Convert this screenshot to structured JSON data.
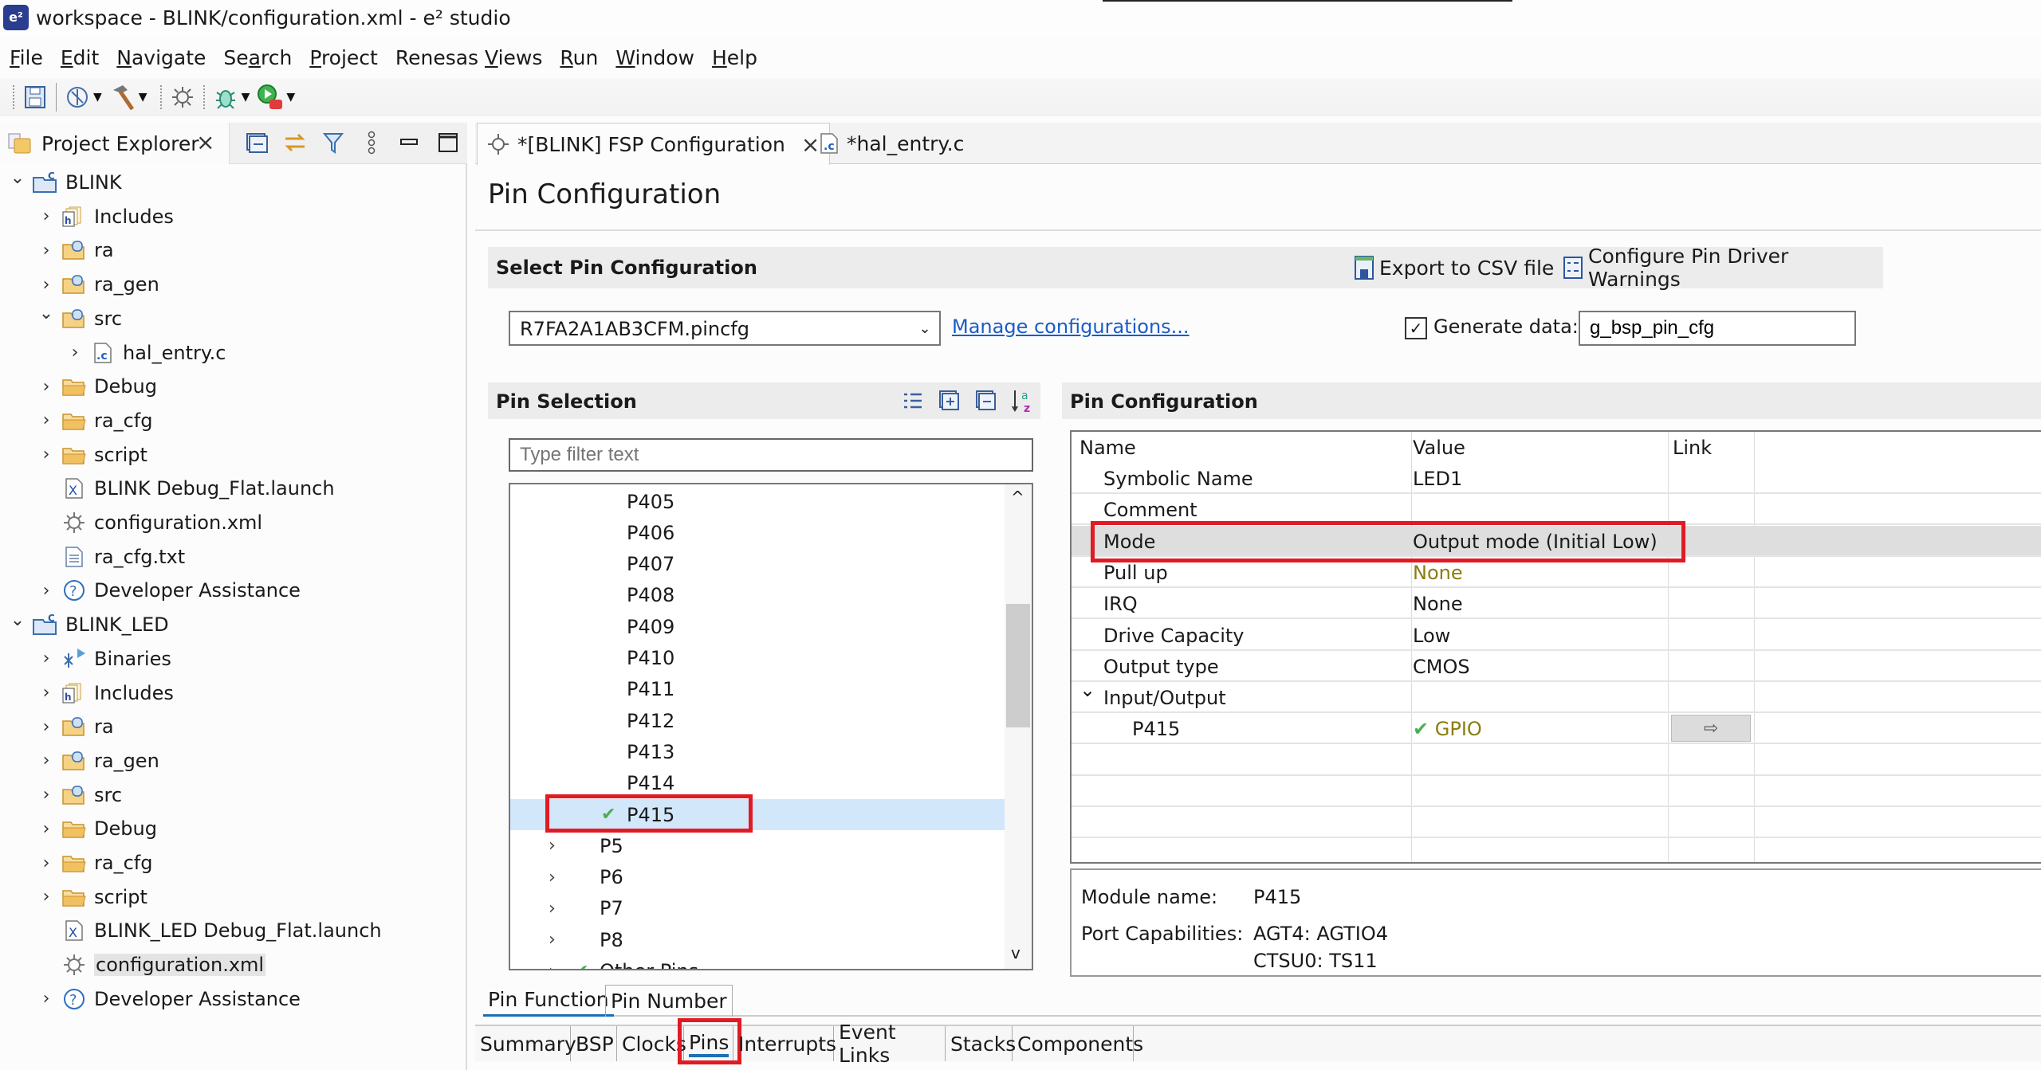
{
  "window": {
    "title": "workspace - BLINK/configuration.xml - e² studio",
    "app_icon": "e2-studio-icon"
  },
  "menu": [
    {
      "label": "File",
      "mnemonic": "F",
      "rest": "ile"
    },
    {
      "label": "Edit",
      "mnemonic": "E",
      "rest": "dit"
    },
    {
      "label": "Navigate",
      "mnemonic": "N",
      "rest": "avigate"
    },
    {
      "label": "Search",
      "pre": "Se",
      "mnemonic": "a",
      "rest": "rch"
    },
    {
      "label": "Project",
      "mnemonic": "P",
      "rest": "roject"
    },
    {
      "label": "Renesas Views",
      "pre": "Renesas ",
      "mnemonic": "V",
      "rest": "iews"
    },
    {
      "label": "Run",
      "mnemonic": "R",
      "rest": "un"
    },
    {
      "label": "Window",
      "mnemonic": "W",
      "rest": "indow"
    },
    {
      "label": "Help",
      "mnemonic": "H",
      "rest": "elp"
    }
  ],
  "toolbar": {
    "icons": [
      "save-icon",
      "build-configuration-icon",
      "build-hammer-icon",
      "fsp-settings-icon",
      "debug-icon",
      "run-icon"
    ]
  },
  "project_explorer": {
    "title": "Project Explorer",
    "tree": [
      {
        "label": "BLINK",
        "level": 0,
        "chevron": "down",
        "icon": "c-project"
      },
      {
        "label": "Includes",
        "level": 1,
        "chevron": "right",
        "icon": "includes"
      },
      {
        "label": "ra",
        "level": 1,
        "chevron": "right",
        "icon": "src-folder"
      },
      {
        "label": "ra_gen",
        "level": 1,
        "chevron": "right",
        "icon": "src-folder"
      },
      {
        "label": "src",
        "level": 1,
        "chevron": "down",
        "icon": "src-folder"
      },
      {
        "label": "hal_entry.c",
        "level": 2,
        "chevron": "right",
        "icon": "c-file"
      },
      {
        "label": "Debug",
        "level": 1,
        "chevron": "right",
        "icon": "folder"
      },
      {
        "label": "ra_cfg",
        "level": 1,
        "chevron": "right",
        "icon": "folder"
      },
      {
        "label": "script",
        "level": 1,
        "chevron": "right",
        "icon": "folder"
      },
      {
        "label": "BLINK Debug_Flat.launch",
        "level": 1,
        "chevron": "",
        "icon": "launch-file"
      },
      {
        "label": "configuration.xml",
        "level": 1,
        "chevron": "",
        "icon": "config-file"
      },
      {
        "label": "ra_cfg.txt",
        "level": 1,
        "chevron": "",
        "icon": "text-file"
      },
      {
        "label": "Developer Assistance",
        "level": 1,
        "chevron": "right",
        "icon": "help"
      },
      {
        "label": "BLINK_LED",
        "level": 0,
        "chevron": "down",
        "icon": "c-project"
      },
      {
        "label": "Binaries",
        "level": 1,
        "chevron": "right",
        "icon": "binaries"
      },
      {
        "label": "Includes",
        "level": 1,
        "chevron": "right",
        "icon": "includes"
      },
      {
        "label": "ra",
        "level": 1,
        "chevron": "right",
        "icon": "src-folder"
      },
      {
        "label": "ra_gen",
        "level": 1,
        "chevron": "right",
        "icon": "src-folder"
      },
      {
        "label": "src",
        "level": 1,
        "chevron": "right",
        "icon": "src-folder"
      },
      {
        "label": "Debug",
        "level": 1,
        "chevron": "right",
        "icon": "folder"
      },
      {
        "label": "ra_cfg",
        "level": 1,
        "chevron": "right",
        "icon": "folder"
      },
      {
        "label": "script",
        "level": 1,
        "chevron": "right",
        "icon": "folder"
      },
      {
        "label": "BLINK_LED Debug_Flat.launch",
        "level": 1,
        "chevron": "",
        "icon": "launch-file"
      },
      {
        "label": "configuration.xml",
        "level": 1,
        "chevron": "",
        "icon": "config-file",
        "selected": true
      },
      {
        "label": "Developer Assistance",
        "level": 1,
        "chevron": "right",
        "icon": "help"
      }
    ]
  },
  "editor_tabs": [
    {
      "label": "*[BLINK] FSP Configuration",
      "active": true,
      "closable": true
    },
    {
      "label": "*hal_entry.c",
      "active": false
    }
  ],
  "page": {
    "title": "Pin Configuration",
    "select_section": "Select Pin Configuration",
    "export_csv": "Export to CSV file",
    "configure_warnings": "Configure Pin Driver Warnings",
    "config_file": "R7FA2A1AB3CFM.pincfg",
    "manage_link": "Manage configurations...",
    "generate_data_label": "Generate data:",
    "generate_data_checked": true,
    "generate_data_value": "g_bsp_pin_cfg"
  },
  "pin_selection": {
    "title": "Pin Selection",
    "filter_placeholder": "Type filter text",
    "pins": [
      {
        "label": "P405"
      },
      {
        "label": "P406"
      },
      {
        "label": "P407"
      },
      {
        "label": "P408"
      },
      {
        "label": "P409"
      },
      {
        "label": "P410"
      },
      {
        "label": "P411"
      },
      {
        "label": "P412"
      },
      {
        "label": "P413"
      },
      {
        "label": "P414"
      },
      {
        "label": "P415",
        "checked": true,
        "selected": true,
        "highlighted": true
      },
      {
        "label": "P5",
        "group": true
      },
      {
        "label": "P6",
        "group": true
      },
      {
        "label": "P7",
        "group": true
      },
      {
        "label": "P8",
        "group": true
      },
      {
        "label": "Other Pins",
        "group": true,
        "checked": true
      }
    ]
  },
  "pin_config": {
    "title": "Pin Configuration",
    "columns": [
      "Name",
      "Value",
      "Link"
    ],
    "rows": [
      {
        "name": "Symbolic Name",
        "value": "LED1"
      },
      {
        "name": "Comment",
        "value": ""
      },
      {
        "name": "Mode",
        "value": "Output mode (Initial Low)",
        "highlighted": true
      },
      {
        "name": "Pull up",
        "value": "None",
        "value_style": "olive"
      },
      {
        "name": "IRQ",
        "value": "None"
      },
      {
        "name": "Drive Capacity",
        "value": "Low"
      },
      {
        "name": "Output type",
        "value": "CMOS"
      },
      {
        "name": "Input/Output",
        "value": "",
        "expandable": true
      },
      {
        "name": "P415",
        "value": "GPIO",
        "value_style": "olive",
        "checked": true,
        "link": "arrow"
      }
    ],
    "module_name_label": "Module name:",
    "module_name": "P415",
    "capabilities_label": "Port Capabilities:",
    "capabilities": [
      "AGT4: AGTIO4",
      "CTSU0: TS11"
    ]
  },
  "pin_view_tabs": [
    {
      "label": "Pin Function",
      "active": true
    },
    {
      "label": "Pin Number",
      "active": false
    }
  ],
  "bottom_tabs": [
    {
      "label": "Summary"
    },
    {
      "label": "BSP"
    },
    {
      "label": "Clocks"
    },
    {
      "label": "Pins",
      "active": true,
      "highlighted": true
    },
    {
      "label": "Interrupts"
    },
    {
      "label": "Event Links"
    },
    {
      "label": "Stacks"
    },
    {
      "label": "Components"
    }
  ],
  "colors": {
    "highlight_box": "#e01b24",
    "selection": "#d3e7fb",
    "link": "#1b5cc4",
    "active_tab_underline": "#1a6fb5",
    "olive_value": "#8a7d10",
    "check_green": "#4caf50"
  }
}
